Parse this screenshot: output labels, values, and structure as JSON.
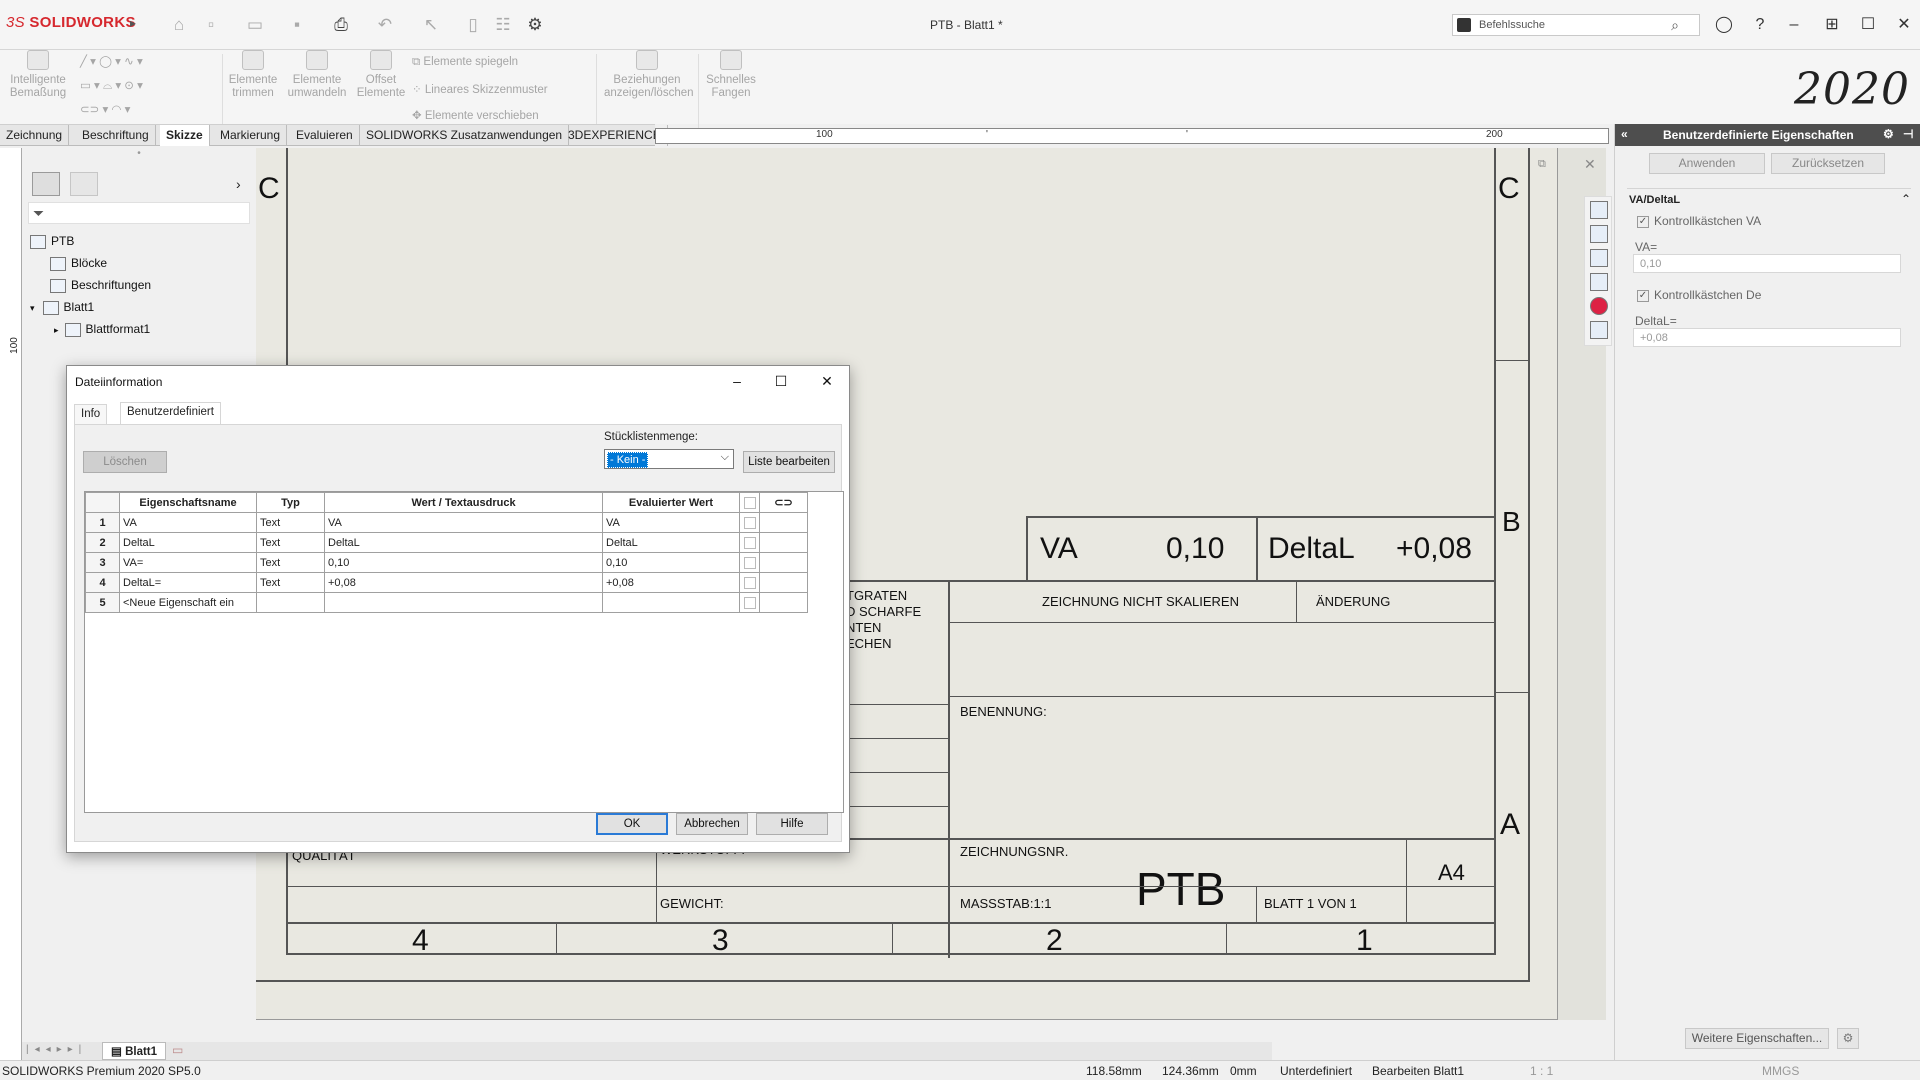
{
  "app": {
    "logo_brand": "3S",
    "logo_name": "SOLIDWORKS",
    "document_title": "PTB - Blatt1 *",
    "search_placeholder": "Befehlssuche",
    "year_badge": "2020"
  },
  "ribbon": {
    "smart_dimension": "Intelligente Bemaßung",
    "trim_entities": "Elemente trimmen",
    "convert_entities": "Elemente umwandeln",
    "offset_entities": "Offset Elemente",
    "mirror_entities": "Elemente spiegeln",
    "linear_pattern": "Lineares Skizzenmuster",
    "move_entities": "Elemente verschieben",
    "relations": "Beziehungen anzeigen/löschen",
    "quick_snaps": "Schnelles Fangen"
  },
  "tabs": [
    "Zeichnung",
    "Beschriftung",
    "Skizze",
    "Markierung",
    "Evaluieren",
    "SOLIDWORKS Zusatzanwendungen",
    "3DEXPERIENCE"
  ],
  "active_tab": "Skizze",
  "ruler": {
    "label_100": "100",
    "label_200": "200",
    "left_100": "100"
  },
  "feature_tree": {
    "root": "PTB",
    "items": [
      "Blöcke",
      "Beschriftungen",
      "Blatt1",
      "Blattformat1"
    ]
  },
  "drawing": {
    "zone_c_left": "C",
    "zone_c_right": "C",
    "zone_b": "B",
    "zone_a": "A",
    "va_label": "VA",
    "va_value": "0,10",
    "delta_label": "DeltaL",
    "delta_value": "+0,08",
    "deburr_1": "TGRATEN",
    "deburr_2": "D SCHARFE",
    "deburr_3": "NTEN",
    "deburr_4": "ECHEN",
    "no_scale": "ZEICHNUNG NICHT SKALIEREN",
    "change": "ÄNDERUNG",
    "name_label": "BENENNUNG:",
    "quality": "QUALITÄT",
    "material": "WERKSTOFF:",
    "drawing_no_label": "ZEICHNUNGSNR.",
    "drawing_no": "PTB",
    "size": "A4",
    "weight": "GEWICHT:",
    "scale": "MASSSTAB:1:1",
    "sheet": "BLATT 1 VON 1",
    "col4": "4",
    "col3": "3",
    "col2": "2",
    "col1": "1"
  },
  "right_panel": {
    "title": "Benutzerdefinierte Eigenschaften",
    "apply": "Anwenden",
    "reset": "Zurücksetzen",
    "group": "VA/DeltaL",
    "checkbox_va": "Kontrollkästchen VA",
    "va_label": "VA=",
    "va_value": "0,10",
    "checkbox_de": "Kontrollkästchen De",
    "delta_label": "DeltaL=",
    "delta_value": "+0,08",
    "more": "Weitere Eigenschaften..."
  },
  "dialog": {
    "title": "Dateiinformation",
    "tab_info": "Info",
    "tab_custom": "Benutzerdefiniert",
    "delete": "Löschen",
    "bom_label": "Stücklistenmenge:",
    "bom_value": "- Kein -",
    "edit_list": "Liste bearbeiten",
    "columns": [
      "Eigenschaftsname",
      "Typ",
      "Wert / Textausdruck",
      "Evaluierter Wert"
    ],
    "rows": [
      {
        "n": "1",
        "name": "VA",
        "type": "Text",
        "value": "VA",
        "evaluated": "VA"
      },
      {
        "n": "2",
        "name": "DeltaL",
        "type": "Text",
        "value": "DeltaL",
        "evaluated": "DeltaL"
      },
      {
        "n": "3",
        "name": "VA=",
        "type": "Text",
        "value": "0,10",
        "evaluated": "0,10"
      },
      {
        "n": "4",
        "name": "DeltaL=",
        "type": "Text",
        "value": "+0,08",
        "evaluated": "+0,08"
      },
      {
        "n": "5",
        "name": "<Neue Eigenschaft ein",
        "type": "",
        "value": "",
        "evaluated": ""
      }
    ],
    "ok": "OK",
    "cancel": "Abbrechen",
    "help": "Hilfe"
  },
  "sheet_tab": "Blatt1",
  "status": {
    "product": "SOLIDWORKS Premium 2020 SP5.0",
    "x": "118.58mm",
    "y": "124.36mm",
    "z": "0mm",
    "state": "Unterdefiniert",
    "mode": "Bearbeiten Blatt1",
    "scale": "1 : 1",
    "units": "MMGS"
  }
}
